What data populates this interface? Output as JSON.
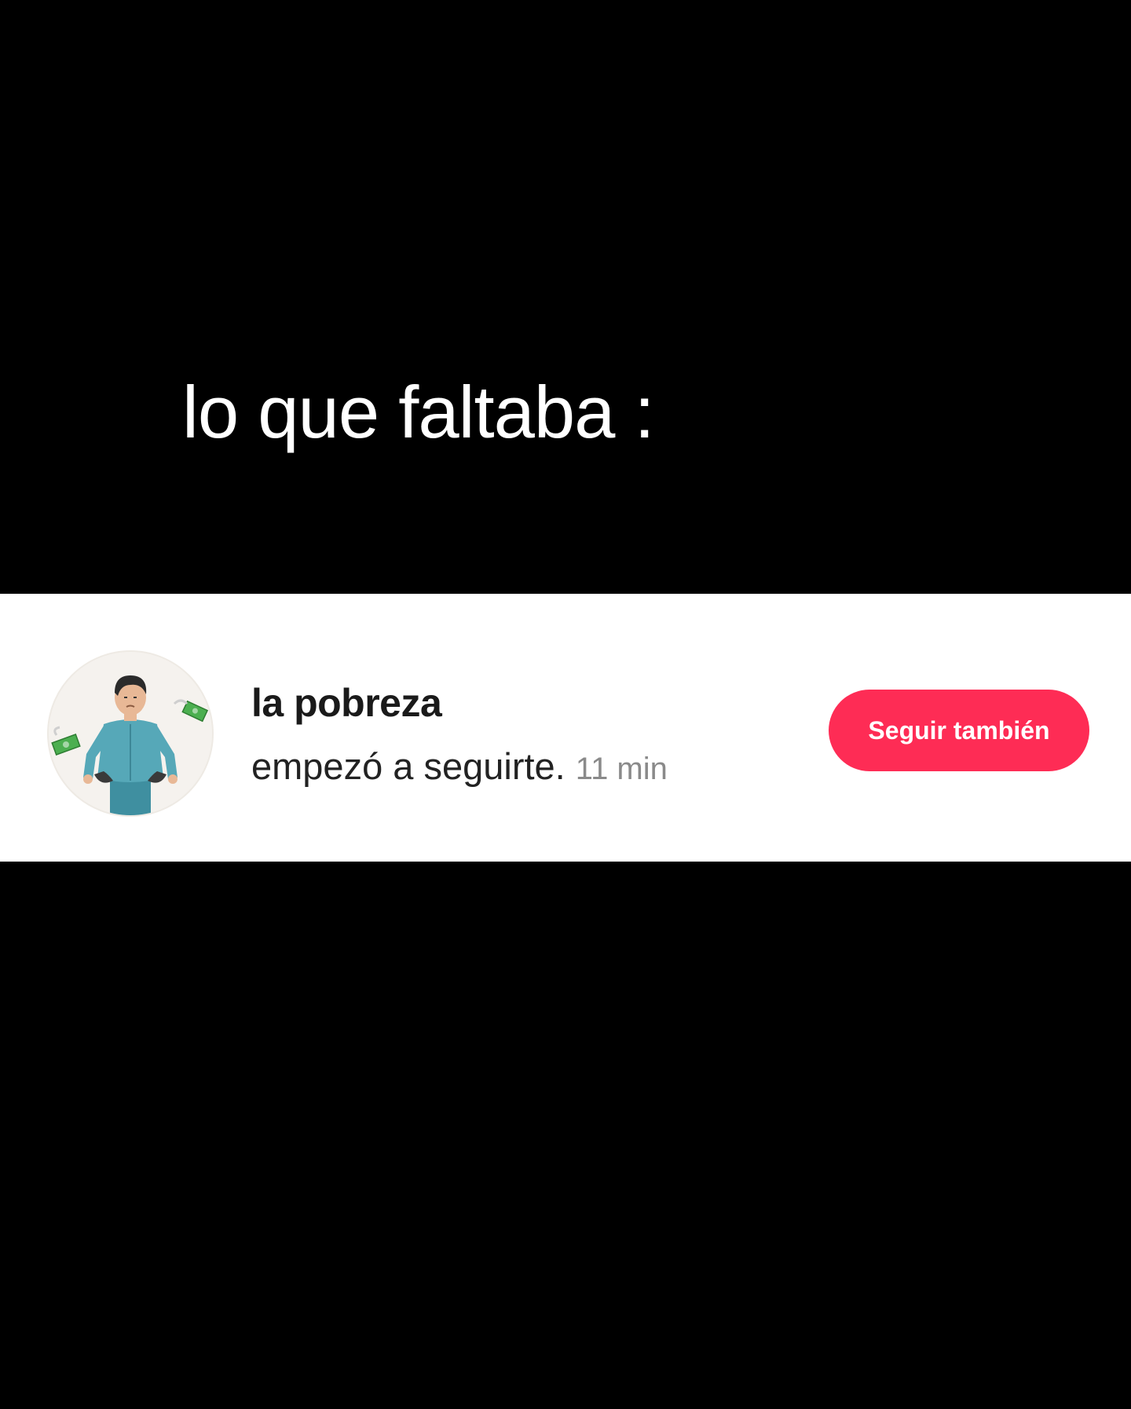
{
  "caption": {
    "text": "lo que faltaba :"
  },
  "notification": {
    "avatar_icon": "person-pockets-empty-with-money-icon",
    "username": "la pobreza",
    "action": "empezó a seguirte.",
    "time": "11 min",
    "follow_button_label": "Seguir también"
  },
  "colors": {
    "background": "#000000",
    "card": "#ffffff",
    "accent": "#fe2c55",
    "muted_text": "#8a8a8a"
  }
}
